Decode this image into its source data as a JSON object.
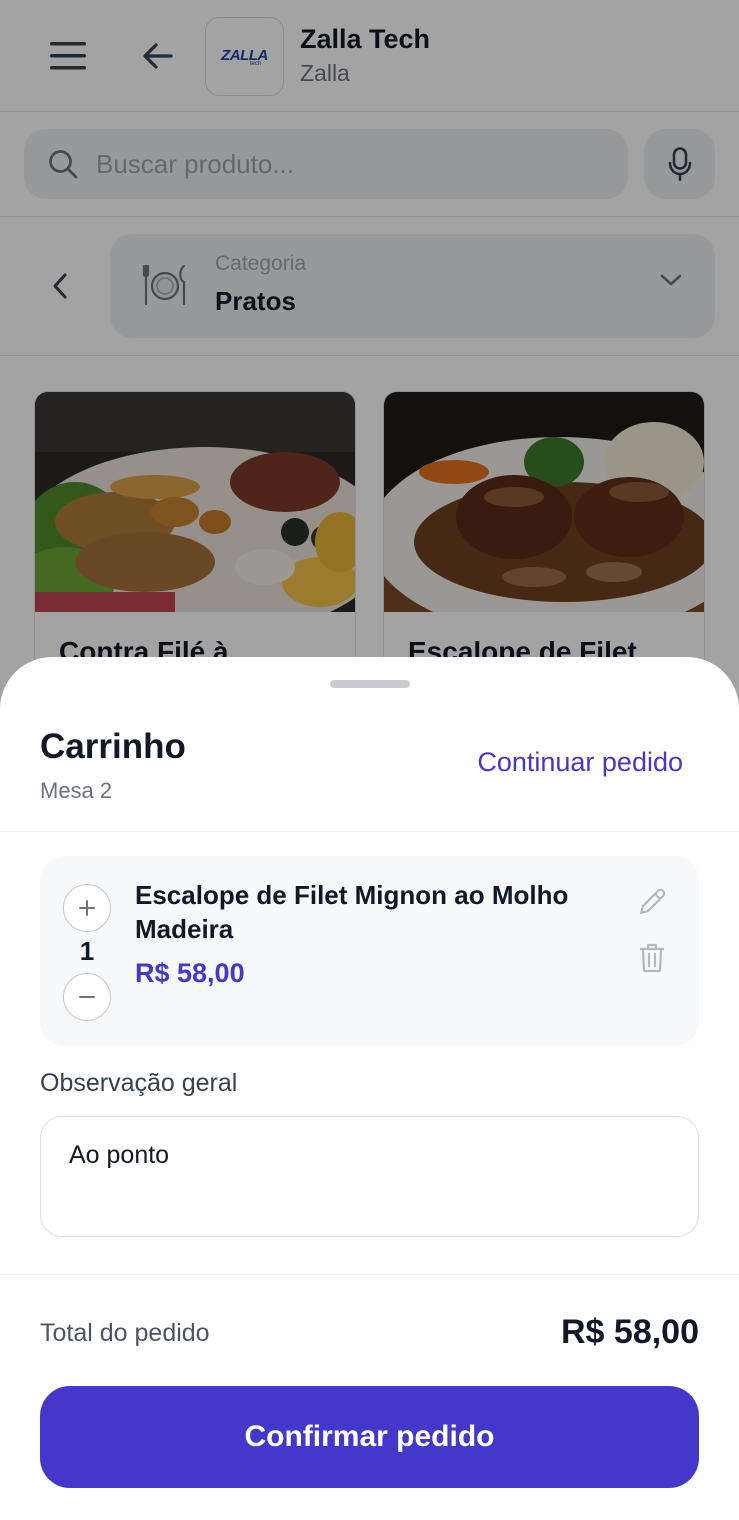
{
  "header": {
    "brand_name": "Zalla Tech",
    "brand_sub": "Zalla",
    "logo_text": "ZALLA",
    "logo_sub": "tech"
  },
  "search": {
    "placeholder": "Buscar produto..."
  },
  "category": {
    "label": "Categoria",
    "value": "Pratos"
  },
  "products": [
    {
      "name": "Contra Filé à"
    },
    {
      "name": "Escalope de Filet"
    }
  ],
  "cart": {
    "title": "Carrinho",
    "subtitle": "Mesa 2",
    "continue_label": "Continuar pedido",
    "items": [
      {
        "quantity": "1",
        "name": "Escalope de Filet Mignon ao Molho Madeira",
        "price": "R$ 58,00"
      }
    ],
    "observation_label": "Observação geral",
    "observation_value": "Ao ponto",
    "total_label": "Total do pedido",
    "total_value": "R$ 58,00",
    "confirm_label": "Confirmar pedido"
  },
  "colors": {
    "accent": "#4338ca",
    "overlay": "rgba(0,0,0,0.36)"
  },
  "icons": [
    "menu-icon",
    "arrow-left-icon",
    "search-icon",
    "microphone-icon",
    "chevron-left-icon",
    "plate-cutlery-icon",
    "chevron-down-icon",
    "plus-icon",
    "minus-icon",
    "pencil-icon",
    "trash-icon"
  ]
}
